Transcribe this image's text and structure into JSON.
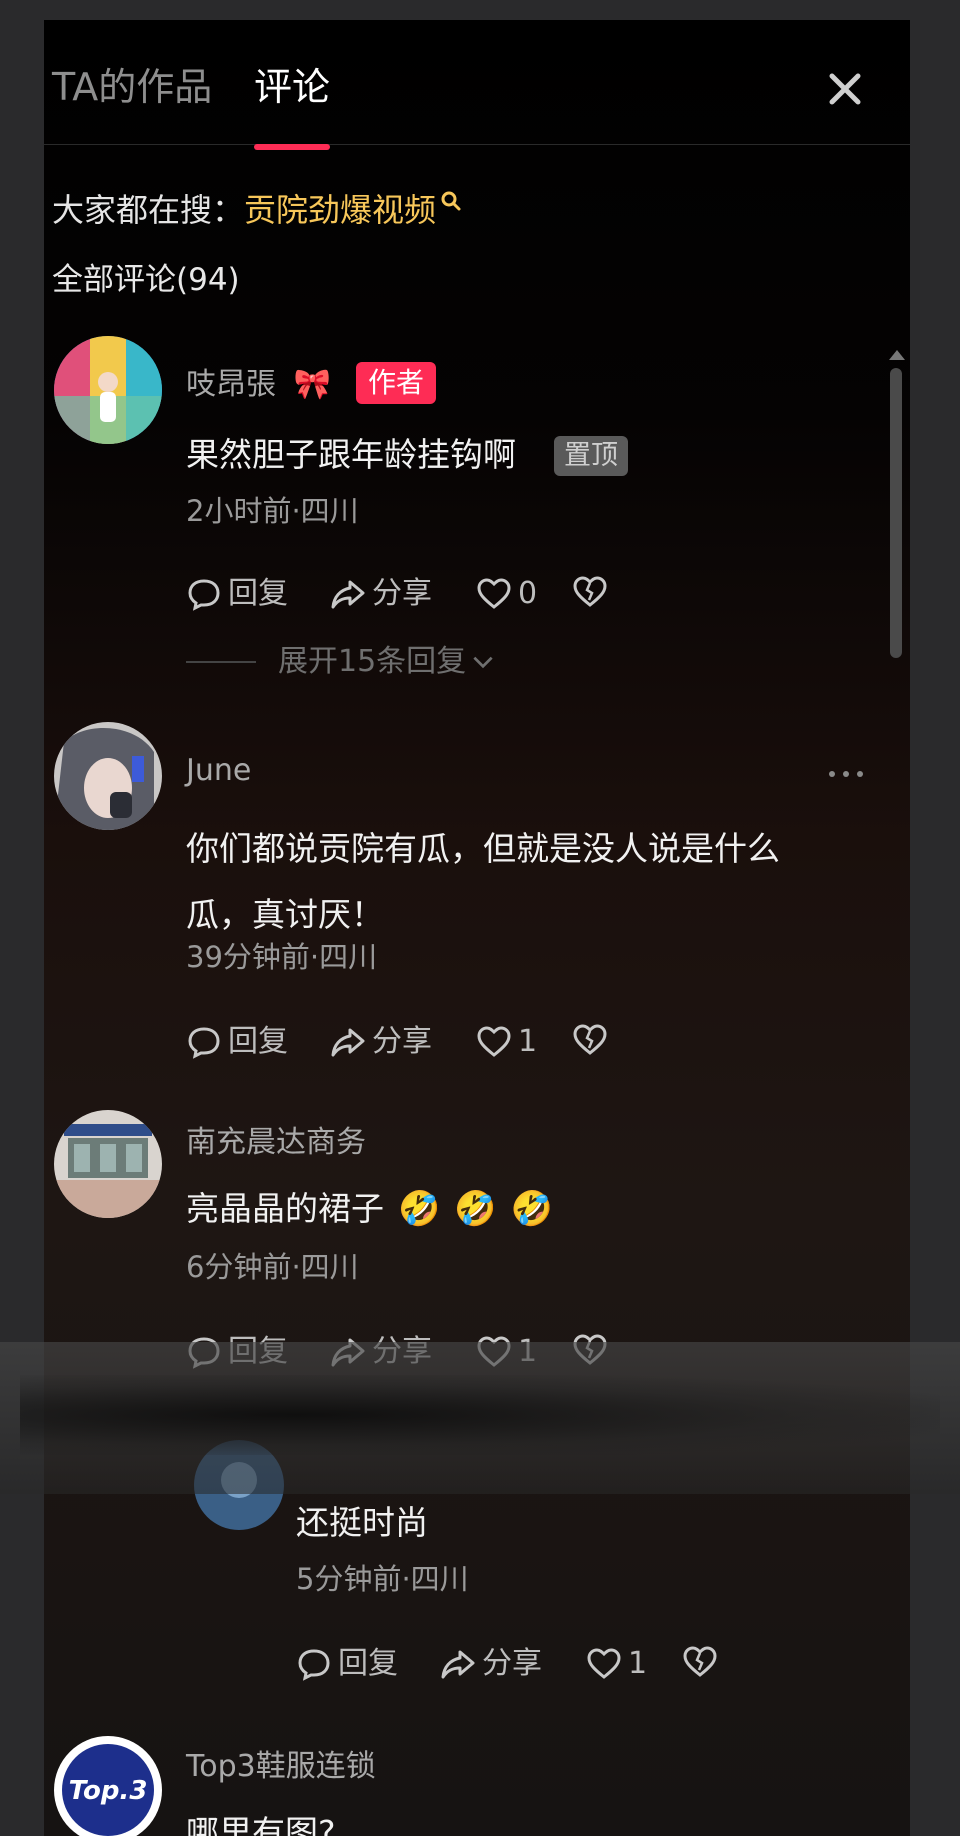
{
  "header": {
    "tab_works": "TA的作品",
    "tab_comments": "评论"
  },
  "search": {
    "prefix": "大家都在搜：",
    "term": "贡院劲爆视频"
  },
  "comments_count_label": "全部评论(94)",
  "comments": [
    {
      "username": "吱昂張",
      "username_emoji": "🎀",
      "author_badge": "作者",
      "text": "果然胆子跟年龄挂钩啊",
      "pinned_badge": "置顶",
      "meta": "2小时前·四川",
      "reply_label": "回复",
      "share_label": "分享",
      "like_count": "0",
      "expand_label": "展开15条回复"
    },
    {
      "username": "June",
      "text": "你们都说贡院有瓜，但就是没人说是什么瓜，真讨厌！",
      "meta": "39分钟前·四川",
      "reply_label": "回复",
      "share_label": "分享",
      "like_count": "1"
    },
    {
      "username": "南充晨达商务",
      "text": "亮晶晶的裙子",
      "emojis": [
        "🤣",
        "🤣",
        "🤣"
      ],
      "meta": "6分钟前·四川",
      "reply_label": "回复",
      "share_label": "分享",
      "like_count": "1"
    },
    {
      "text": "还挺时尚",
      "meta": "5分钟前·四川",
      "reply_label": "回复",
      "share_label": "分享",
      "like_count": "1"
    },
    {
      "username": "Top3鞋服连锁",
      "avatar_text": "Top.3",
      "text": "哪里有图?"
    }
  ],
  "colors": {
    "accent": "#fe2c55",
    "search_term": "#f7c75a",
    "background": "#2a2a2c"
  }
}
